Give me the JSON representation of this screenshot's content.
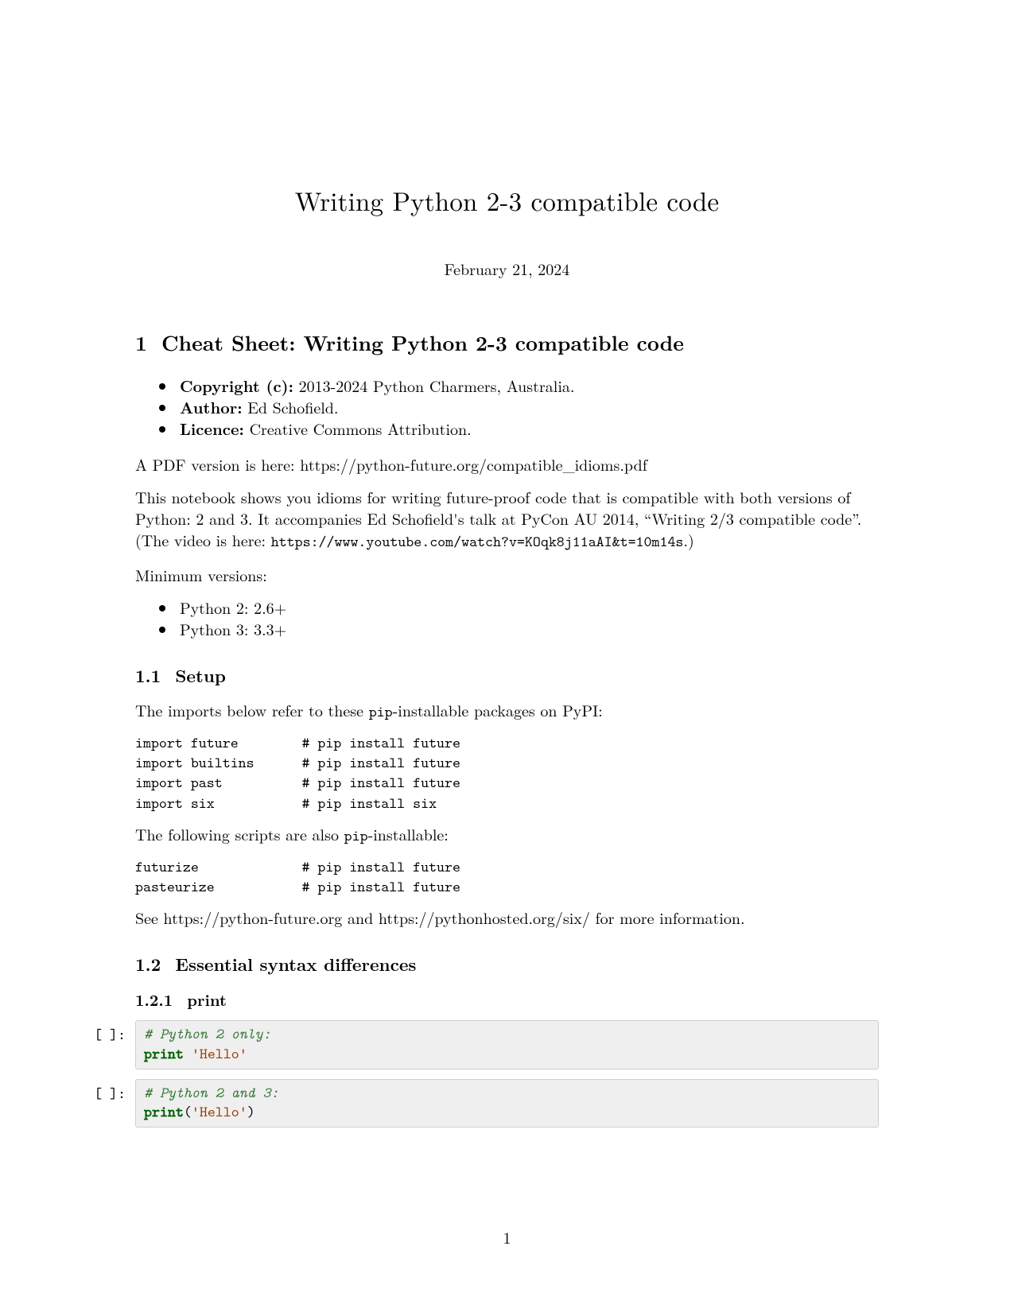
{
  "title": "Writing Python 2-3 compatible code",
  "date": "February 21, 2024",
  "section1": {
    "num": "1",
    "title": "Cheat Sheet: Writing Python 2-3 compatible code"
  },
  "meta": {
    "copyright_label": "Copyright (c):",
    "copyright_value": " 2013-2024 Python Charmers, Australia.",
    "author_label": "Author:",
    "author_value": " Ed Schofield.",
    "licence_label": "Licence:",
    "licence_value": " Creative Commons Attribution."
  },
  "pdf_line_pre": "A PDF version is here: ",
  "pdf_line_url": "https://python-future.org/compatible_idioms.pdf",
  "intro_para_1": "This notebook shows you idioms for writing future-proof code that is compatible with both versions of Python: 2 and 3. It accompanies Ed Schofield's talk at PyCon AU 2014, “Writing 2/3 compatible code”. (The video is here: ",
  "intro_video_url": "https://www.youtube.com/watch?v=KOqk8j11aAI&t=10m14s",
  "intro_para_1_tail": ".)",
  "min_versions_label": "Minimum versions:",
  "min_versions": {
    "py2": "Python 2: 2.6+",
    "py3": "Python 3: 3.3+"
  },
  "setup": {
    "num": "1.1",
    "title": "Setup",
    "lead_pre": "The imports below refer to these ",
    "lead_tt": "pip",
    "lead_post": "-installable packages on PyPI:",
    "code1": "import future        # pip install future\nimport builtins      # pip install future\nimport past          # pip install future\nimport six           # pip install six",
    "lead2_pre": "The following scripts are also ",
    "lead2_tt": "pip",
    "lead2_post": "-installable:",
    "code2": "futurize             # pip install future\npasteurize           # pip install future",
    "see_pre": "See ",
    "see_url1": "https://python-future.org",
    "see_mid": " and ",
    "see_url2": "https://pythonhosted.org/six/",
    "see_post": " for more information."
  },
  "essentials": {
    "num": "1.2",
    "title": "Essential syntax differences",
    "print": {
      "num": "1.2.1",
      "title": "print"
    }
  },
  "cells": {
    "prompt": "[ ]:",
    "c1_comment": "# Python 2 only:",
    "c1_code_kw": "print",
    "c1_code_str": " 'Hello'",
    "c2_comment": "# Python 2 and 3:",
    "c2_code_kw": "print",
    "c2_code_paren_open": "(",
    "c2_code_str": "'Hello'",
    "c2_code_paren_close": ")"
  },
  "page_number": "1"
}
